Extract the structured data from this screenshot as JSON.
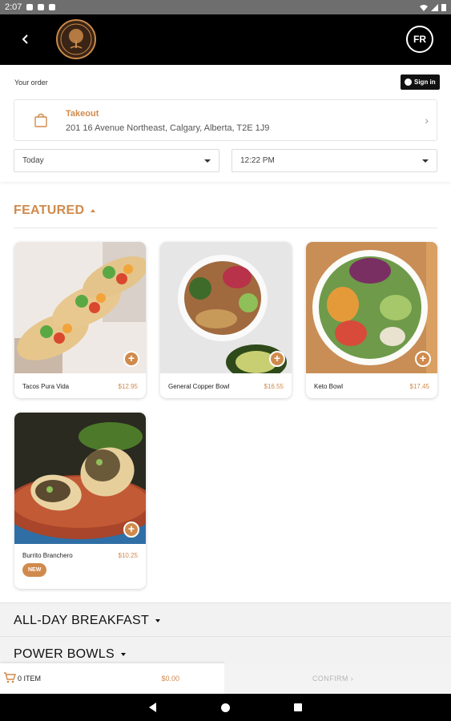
{
  "status_bar": {
    "time": "2:07"
  },
  "header": {
    "lang_label": "FR"
  },
  "order": {
    "your_order_label": "Your order",
    "sign_in_label": "Sign in",
    "mode_label": "Takeout",
    "address": "201 16 Avenue Northeast, Calgary, Alberta, T2E 1J9",
    "day_value": "Today",
    "time_value": "12:22 PM"
  },
  "featured": {
    "title": "FEATURED",
    "items": [
      {
        "name": "Tacos Pura Vida",
        "price": "$12.95"
      },
      {
        "name": "General Copper Bowl",
        "price": "$16.55"
      },
      {
        "name": "Keto Bowl",
        "price": "$17.45"
      },
      {
        "name": "Burrito Branchero",
        "price": "$10.25",
        "badge": "NEW"
      }
    ]
  },
  "sections": [
    {
      "title": "ALL-DAY BREAKFAST"
    },
    {
      "title": "POWER BOWLS"
    }
  ],
  "cart": {
    "count_label": "0 ITEM",
    "total": "$0.00",
    "confirm_label": "CONFIRM"
  },
  "colors": {
    "accent": "#d08a4c",
    "header_bg": "#000000"
  }
}
